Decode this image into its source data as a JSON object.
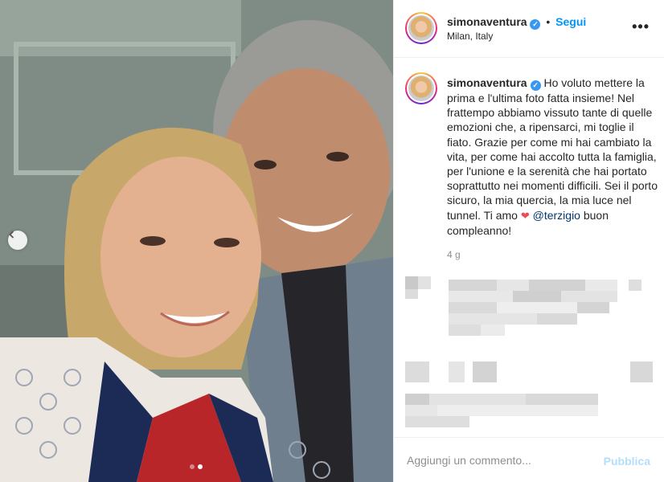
{
  "post": {
    "username": "simonaventura",
    "follow_label": "Segui",
    "separator": "•",
    "location": "Milan, Italy",
    "more_icon": "more-horizontal-icon",
    "verified_icon": "verified-badge-icon",
    "caption_text": "Ho voluto mettere la prima e l'ultima foto fatta insieme! Nel frattempo abbiamo vissuto tante di quelle emozioni che, a ripensarci, mi toglie il fiato. Grazie per come mi hai cambiato la vita, per come hai accolto tutta la famiglia, per l'unione e la serenità che hai portato soprattutto nei momenti difficili. Sei il porto sicuro, la mia quercia, la mia luce nel tunnel. Ti amo",
    "heart_emoji": "❤",
    "mention": "@terzigio",
    "caption_end": "buon compleanno!",
    "time_ago": "4 g",
    "comment_placeholder": "Aggiungi un commento...",
    "publish_label": "Pubblica",
    "carousel": {
      "total": 2,
      "active": 2
    }
  },
  "colors": {
    "follow_blue": "#0095f6",
    "verified_blue": "#3897f0",
    "publish_disabled": "#b2dffc",
    "heart_red": "#ed4956",
    "mention": "#00376b"
  }
}
